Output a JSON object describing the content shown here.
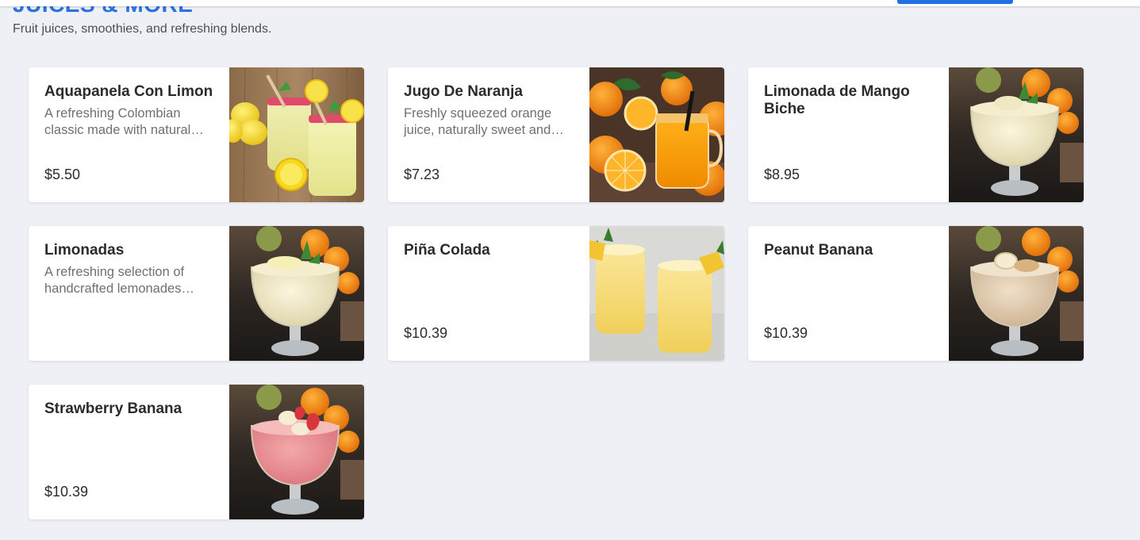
{
  "section": {
    "title": "JUICES & MORE",
    "subtitle": "Fruit juices, smoothies, and refreshing blends."
  },
  "items": [
    {
      "name": "Aquapanela Con Limon",
      "description": "A refreshing Colombian classic made with natural…",
      "price": "$5.50",
      "image": "lemonade-jars-photo"
    },
    {
      "name": "Jugo De Naranja",
      "description": "Freshly squeezed orange juice, naturally sweet and…",
      "price": "$7.23",
      "image": "orange-juice-jar-photo"
    },
    {
      "name": "Limonada de Mango Biche",
      "description": "",
      "price": "$8.95",
      "image": "cream-smoothie-goblet-photo"
    },
    {
      "name": "Limonadas",
      "description": "A refreshing selection of handcrafted lemonades…",
      "price": "",
      "image": "lemonade-goblet-photo"
    },
    {
      "name": "Piña Colada",
      "description": "",
      "price": "$10.39",
      "image": "pina-colada-glasses-photo"
    },
    {
      "name": "Peanut Banana",
      "description": "",
      "price": "$10.39",
      "image": "peanut-banana-goblet-photo"
    },
    {
      "name": "Strawberry Banana",
      "description": "",
      "price": "$10.39",
      "image": "strawberry-banana-goblet-photo"
    }
  ],
  "colors": {
    "accent": "#2a72e0",
    "background": "#eff0f5",
    "card": "#ffffff"
  }
}
